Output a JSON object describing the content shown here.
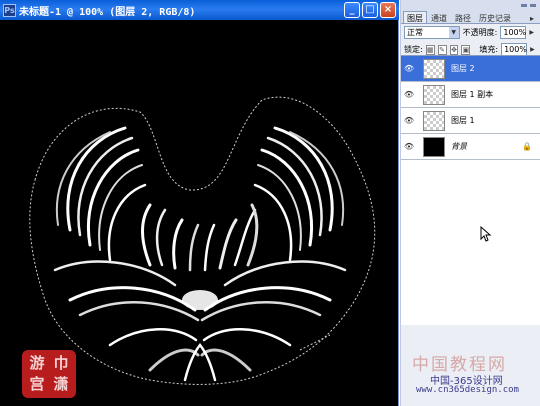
{
  "document": {
    "title": "未标题-1 @ 100% (图层 2, RGB/8)",
    "app_icon": "photoshop-icon",
    "window_buttons": [
      "_",
      "□",
      "×"
    ]
  },
  "seal": {
    "chars": [
      "游",
      "巾",
      "宫",
      "潇"
    ]
  },
  "layers_panel": {
    "tabs": [
      "图层",
      "通道",
      "路径",
      "历史记录"
    ],
    "blend_mode": "正常",
    "opacity_label": "不透明度:",
    "opacity_value": "100%",
    "lock_label": "锁定:",
    "fill_label": "填充:",
    "fill_value": "100%",
    "layers": [
      {
        "name": "图层 2",
        "selected": true,
        "thumb": "transparent"
      },
      {
        "name": "图层 1 副本",
        "selected": false,
        "thumb": "transparent"
      },
      {
        "name": "图层 1",
        "selected": false,
        "thumb": "transparent"
      },
      {
        "name": "背景",
        "selected": false,
        "thumb": "black",
        "locked": true
      }
    ]
  },
  "watermark": {
    "big": "中国教程网",
    "line1": "中国-365设计网",
    "line2": "www.cn365design.com"
  },
  "colors": {
    "title_bar": "#0a5fd8",
    "selected_layer": "#3a6ed8",
    "seal": "#b81d1d"
  }
}
